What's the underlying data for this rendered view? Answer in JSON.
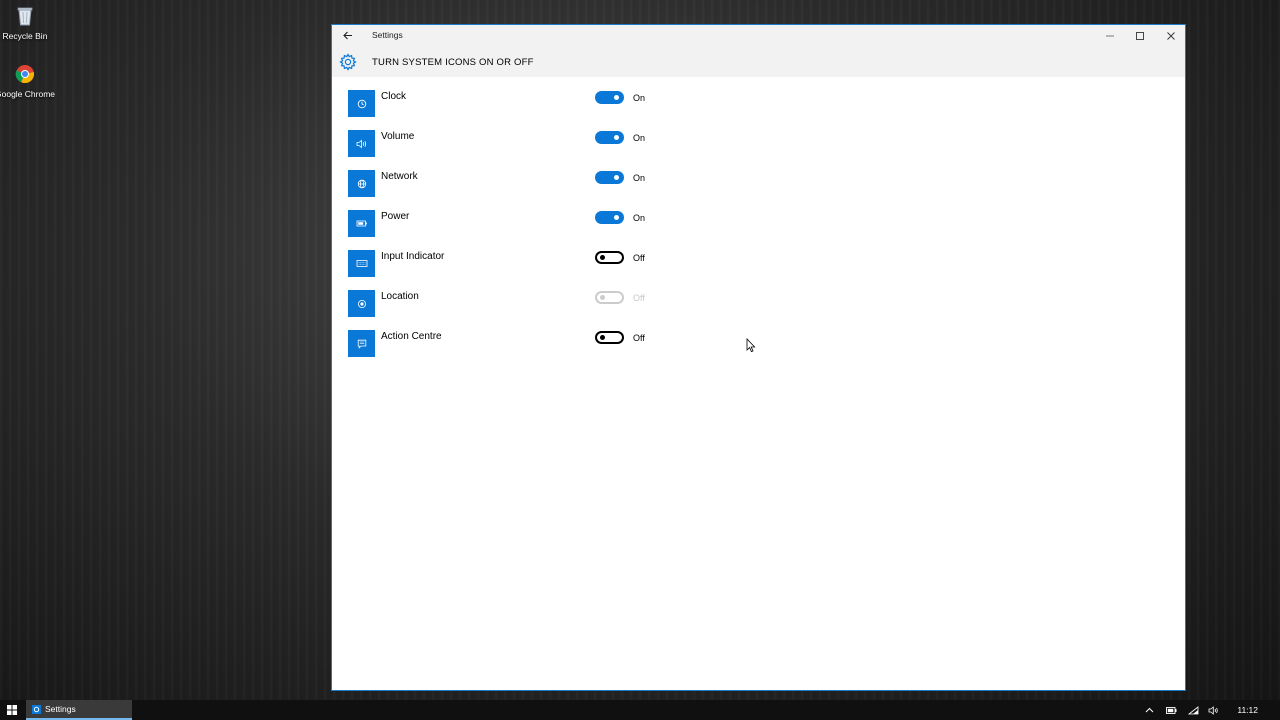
{
  "desktop": {
    "icons": [
      {
        "label": "Recycle Bin",
        "icon": "recycle-bin-icon"
      },
      {
        "label": "Google Chrome",
        "icon": "chrome-icon"
      }
    ]
  },
  "window": {
    "title": "Settings",
    "back_icon": "back-arrow-icon",
    "controls": [
      "minimize-icon",
      "maximize-icon",
      "close-icon"
    ]
  },
  "header": {
    "icon": "gear-icon",
    "title": "TURN SYSTEM ICONS ON OR OFF"
  },
  "accent_color": "#0a78d7",
  "items": [
    {
      "label": "Clock",
      "icon": "clock-icon",
      "state": "On",
      "on": true,
      "disabled": false
    },
    {
      "label": "Volume",
      "icon": "volume-icon",
      "state": "On",
      "on": true,
      "disabled": false
    },
    {
      "label": "Network",
      "icon": "network-icon",
      "state": "On",
      "on": true,
      "disabled": false
    },
    {
      "label": "Power",
      "icon": "power-icon",
      "state": "On",
      "on": true,
      "disabled": false
    },
    {
      "label": "Input Indicator",
      "icon": "keyboard-icon",
      "state": "Off",
      "on": false,
      "disabled": false
    },
    {
      "label": "Location",
      "icon": "location-icon",
      "state": "Off",
      "on": false,
      "disabled": true
    },
    {
      "label": "Action Centre",
      "icon": "action-centre-icon",
      "state": "Off",
      "on": false,
      "disabled": false
    }
  ],
  "taskbar": {
    "start_icon": "windows-logo-icon",
    "app_label": "Settings",
    "tray_icons": [
      "chevron-up-icon",
      "battery-icon",
      "wifi-icon",
      "speaker-icon"
    ],
    "time": "11:12"
  }
}
